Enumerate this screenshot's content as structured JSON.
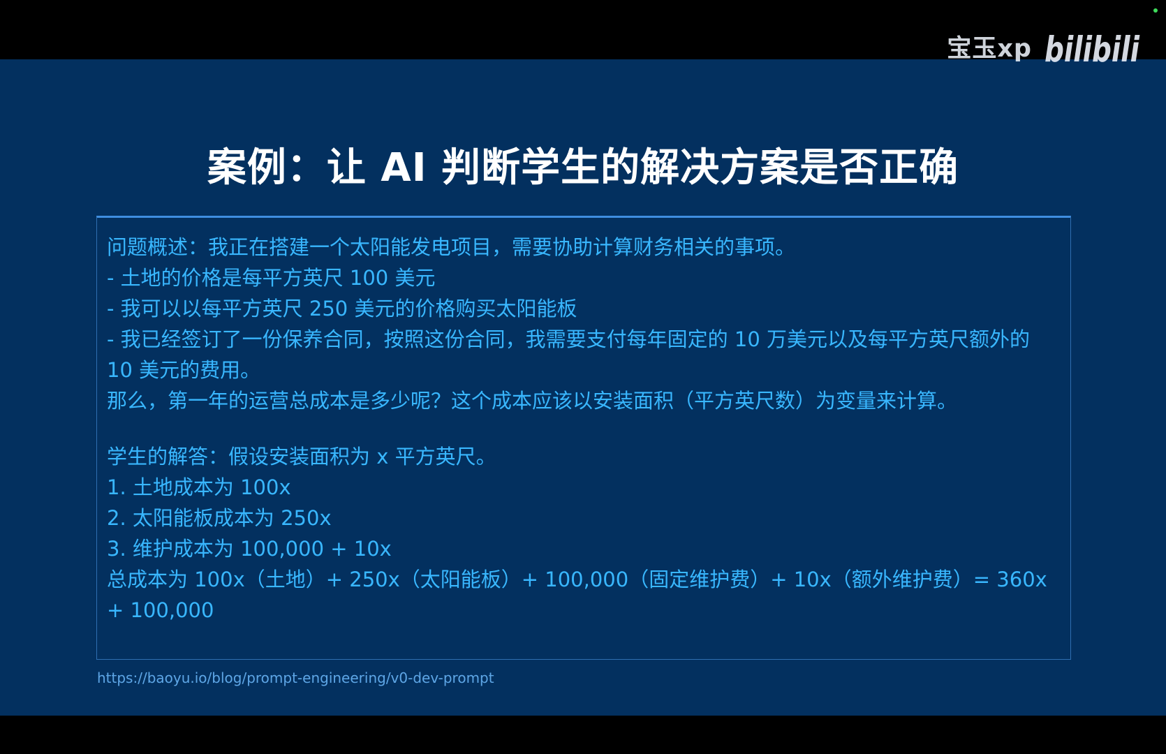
{
  "watermark": {
    "user": "宝玉xp",
    "logo_text": "bilibili"
  },
  "slide": {
    "title": "案例：让 AI 判断学生的解决方案是否正确",
    "problem": {
      "summary": "问题概述：我正在搭建一个太阳能发电项目，需要协助计算财务相关的事项。",
      "item1": "- 土地的价格是每平方英尺 100 美元",
      "item2": "- 我可以以每平方英尺 250 美元的价格购买太阳能板",
      "item3": "- 我已经签订了一份保养合同，按照这份合同，我需要支付每年固定的 10 万美元以及每平方英尺额外的 10 美元的费用。",
      "question": "那么，第一年的运营总成本是多少呢？这个成本应该以安装面积（平方英尺数）为变量来计算。"
    },
    "answer": {
      "intro": "学生的解答：假设安装面积为 x 平方英尺。",
      "step1": "1. 土地成本为 100x",
      "step2": "2. 太阳能板成本为 250x",
      "step3": "3. 维护成本为 100,000 + 10x",
      "total": "总成本为 100x（土地）+ 250x（太阳能板）+ 100,000（固定维护费）+ 10x（额外维护费）= 360x + 100,000"
    },
    "source_url": "https://baoyu.io/blog/prompt-engineering/v0-dev-prompt"
  },
  "colors": {
    "slide_background": "#03305f",
    "title": "#ffffff",
    "body_text": "#39b7ff",
    "box_border": "#2f6fb2",
    "letterbox": "#000000"
  }
}
